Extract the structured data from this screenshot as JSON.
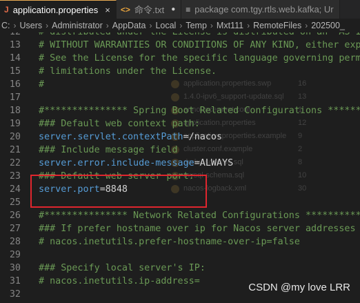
{
  "tabs": [
    {
      "icon": "J",
      "label": "application.properties",
      "close": "×",
      "active": true
    },
    {
      "icon": "<>",
      "label": "命令.txt",
      "close": "●",
      "active": false
    },
    {
      "icon": "≡",
      "label": "package com.tgy.rtls.web.kafka; Ur",
      "close": "",
      "active": false
    }
  ],
  "breadcrumb": [
    "C:",
    "Users",
    "Administrator",
    "AppData",
    "Local",
    "Temp",
    "Mxt111",
    "RemoteFiles",
    "202500_"
  ],
  "colors": {
    "comment": "#6a9955",
    "key": "#569cd6",
    "highlight_border": "#e0262e"
  },
  "lines": [
    {
      "n": "12",
      "type": "comment",
      "text": "# distributed under the License is distributed on an \"AS IS\" BASIS,"
    },
    {
      "n": "13",
      "type": "comment",
      "text": "# WITHOUT WARRANTIES OR CONDITIONS OF ANY KIND, either express or implied."
    },
    {
      "n": "14",
      "type": "comment",
      "text": "# See the License for the specific language governing permissions and"
    },
    {
      "n": "15",
      "type": "comment",
      "text": "# limitations under the License."
    },
    {
      "n": "16",
      "type": "comment",
      "text": "#"
    },
    {
      "n": "17",
      "type": "empty",
      "text": ""
    },
    {
      "n": "18",
      "type": "comment",
      "text": "#*************** Spring Boot Related Configurations ***************#"
    },
    {
      "n": "19",
      "type": "comment",
      "text": "### Default web context path:"
    },
    {
      "n": "20",
      "type": "kv",
      "key": "server.servlet.contextPath",
      "op": "=",
      "val": "/nacos"
    },
    {
      "n": "21",
      "type": "comment",
      "text": "### Include message field"
    },
    {
      "n": "22",
      "type": "kv",
      "key": "server.error.include-message",
      "op": "=",
      "val": "ALWAYS"
    },
    {
      "n": "23",
      "type": "comment",
      "text": "### Default web server port:"
    },
    {
      "n": "24",
      "type": "kv",
      "key": "server.port",
      "op": "=",
      "val": "8848"
    },
    {
      "n": "25",
      "type": "empty",
      "text": ""
    },
    {
      "n": "26",
      "type": "comment",
      "text": "#*************** Network Related Configurations ***************#"
    },
    {
      "n": "27",
      "type": "comment",
      "text": "### If prefer hostname over ip for Nacos server addresses in cluster.conf:"
    },
    {
      "n": "28",
      "type": "comment",
      "text": "# nacos.inetutils.prefer-hostname-over-ip=false"
    },
    {
      "n": "29",
      "type": "empty",
      "text": ""
    },
    {
      "n": "30",
      "type": "comment",
      "text": "### Specify local server's IP:"
    },
    {
      "n": "31",
      "type": "comment",
      "text": "# nacos.inetutils.ip-address="
    },
    {
      "n": "32",
      "type": "empty",
      "text": ""
    }
  ],
  "ghost_files": [
    {
      "name": "application.properties.swp",
      "num": "16"
    },
    {
      "name": "1.4.0-ipv6_support-update.sql",
      "num": "13"
    },
    {
      "name": "announcement.conf",
      "num": "1"
    },
    {
      "name": "application.properties",
      "num": "12"
    },
    {
      "name": "application.properties.example",
      "num": "9"
    },
    {
      "name": "cluster.conf.example",
      "num": "2"
    },
    {
      "name": "derby-schema.sql",
      "num": "8"
    },
    {
      "name": "mysql-schema.sql",
      "num": "10"
    },
    {
      "name": "nacos-logback.xml",
      "num": "30"
    }
  ],
  "watermark": "CSDN @my love  LRR"
}
